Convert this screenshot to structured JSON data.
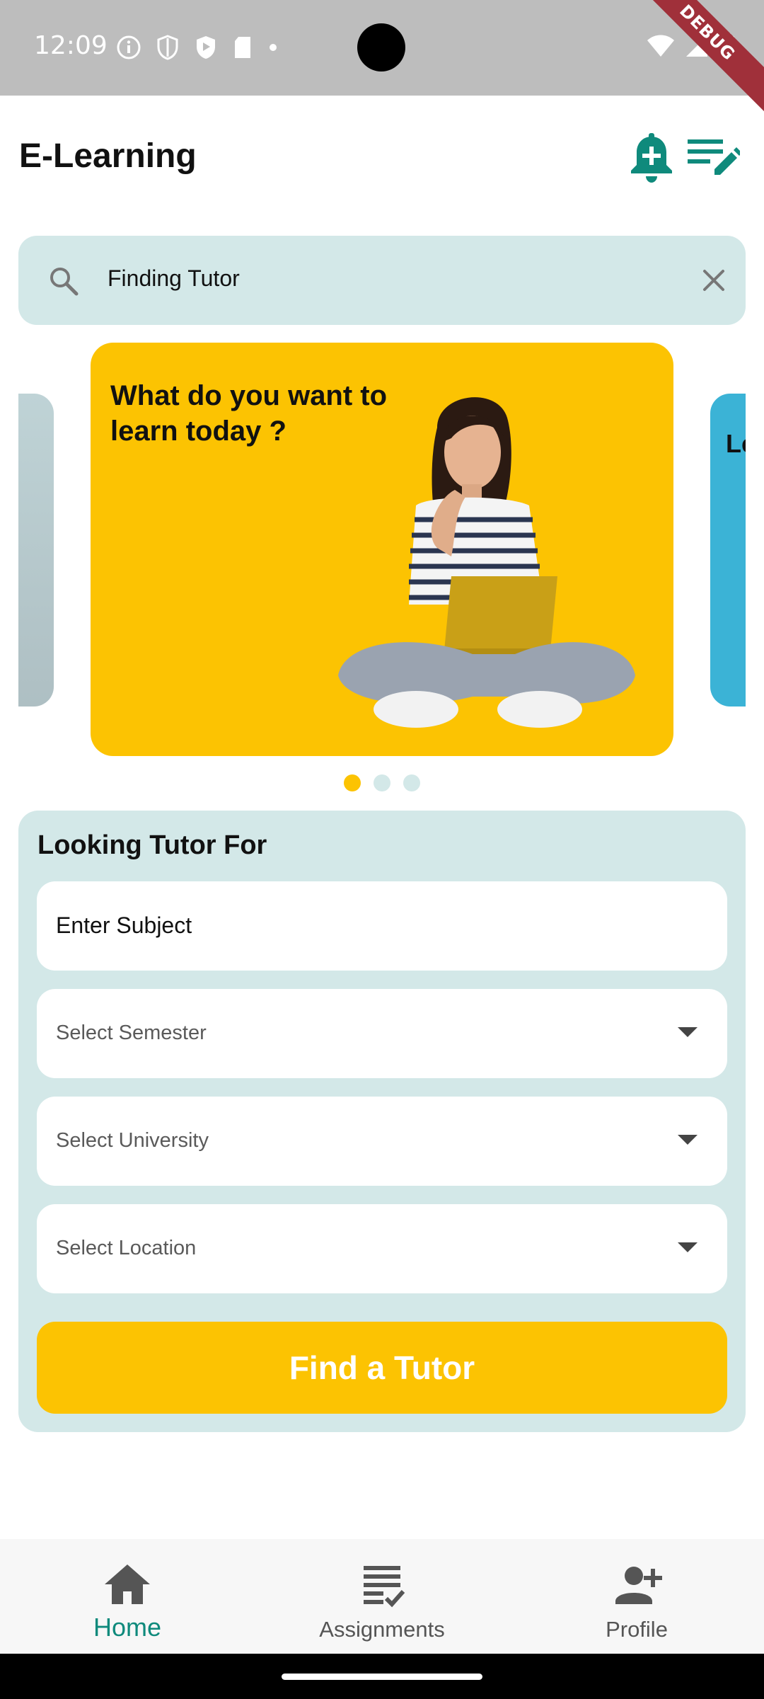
{
  "status_bar": {
    "time": "12:09",
    "debug_banner": "DEBUG"
  },
  "app_bar": {
    "title": "E-Learning",
    "icons": [
      "add-notification-icon",
      "edit-notes-icon"
    ]
  },
  "search": {
    "value": "Finding Tutor",
    "icons": [
      "search-icon",
      "clear-icon"
    ]
  },
  "carousel": {
    "active_card_text": "What do you want to learn today ?",
    "next_card_peek_text": "Le",
    "page_count": 3,
    "active_index": 0
  },
  "form": {
    "title": "Looking Tutor For",
    "subject_placeholder": "Enter Subject",
    "semester_placeholder": "Select Semester",
    "university_placeholder": "Select University",
    "location_placeholder": "Select Location",
    "submit_label": "Find a Tutor"
  },
  "bottom_nav": {
    "items": [
      {
        "label": "Home",
        "icon": "home-icon",
        "active": true
      },
      {
        "label": "Assignments",
        "icon": "assignments-icon",
        "active": false
      },
      {
        "label": "Profile",
        "icon": "person-add-icon",
        "active": false
      }
    ]
  },
  "colors": {
    "accent_teal": "#0f8a7c",
    "accent_yellow": "#fcc302",
    "panel_bg": "#d3e8e8"
  }
}
